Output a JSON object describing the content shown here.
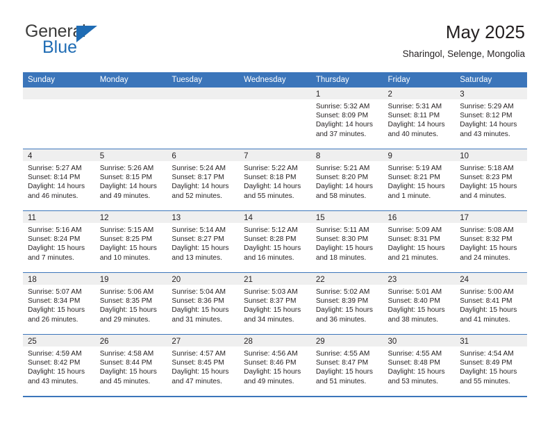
{
  "brand": {
    "name_part1": "General",
    "name_part2": "Blue",
    "logo_icon": "triangle-logo-icon"
  },
  "header": {
    "title": "May 2025",
    "subtitle": "Sharingol, Selenge, Mongolia"
  },
  "calendar": {
    "weekday_headers": [
      "Sunday",
      "Monday",
      "Tuesday",
      "Wednesday",
      "Thursday",
      "Friday",
      "Saturday"
    ],
    "accent_color": "#3b75ba",
    "daynum_band_color": "#efefef",
    "weeks": [
      [
        {
          "day": "",
          "lines": []
        },
        {
          "day": "",
          "lines": []
        },
        {
          "day": "",
          "lines": []
        },
        {
          "day": "",
          "lines": []
        },
        {
          "day": "1",
          "lines": [
            "Sunrise: 5:32 AM",
            "Sunset: 8:09 PM",
            "Daylight: 14 hours",
            "and 37 minutes."
          ]
        },
        {
          "day": "2",
          "lines": [
            "Sunrise: 5:31 AM",
            "Sunset: 8:11 PM",
            "Daylight: 14 hours",
            "and 40 minutes."
          ]
        },
        {
          "day": "3",
          "lines": [
            "Sunrise: 5:29 AM",
            "Sunset: 8:12 PM",
            "Daylight: 14 hours",
            "and 43 minutes."
          ]
        }
      ],
      [
        {
          "day": "4",
          "lines": [
            "Sunrise: 5:27 AM",
            "Sunset: 8:14 PM",
            "Daylight: 14 hours",
            "and 46 minutes."
          ]
        },
        {
          "day": "5",
          "lines": [
            "Sunrise: 5:26 AM",
            "Sunset: 8:15 PM",
            "Daylight: 14 hours",
            "and 49 minutes."
          ]
        },
        {
          "day": "6",
          "lines": [
            "Sunrise: 5:24 AM",
            "Sunset: 8:17 PM",
            "Daylight: 14 hours",
            "and 52 minutes."
          ]
        },
        {
          "day": "7",
          "lines": [
            "Sunrise: 5:22 AM",
            "Sunset: 8:18 PM",
            "Daylight: 14 hours",
            "and 55 minutes."
          ]
        },
        {
          "day": "8",
          "lines": [
            "Sunrise: 5:21 AM",
            "Sunset: 8:20 PM",
            "Daylight: 14 hours",
            "and 58 minutes."
          ]
        },
        {
          "day": "9",
          "lines": [
            "Sunrise: 5:19 AM",
            "Sunset: 8:21 PM",
            "Daylight: 15 hours",
            "and 1 minute."
          ]
        },
        {
          "day": "10",
          "lines": [
            "Sunrise: 5:18 AM",
            "Sunset: 8:23 PM",
            "Daylight: 15 hours",
            "and 4 minutes."
          ]
        }
      ],
      [
        {
          "day": "11",
          "lines": [
            "Sunrise: 5:16 AM",
            "Sunset: 8:24 PM",
            "Daylight: 15 hours",
            "and 7 minutes."
          ]
        },
        {
          "day": "12",
          "lines": [
            "Sunrise: 5:15 AM",
            "Sunset: 8:25 PM",
            "Daylight: 15 hours",
            "and 10 minutes."
          ]
        },
        {
          "day": "13",
          "lines": [
            "Sunrise: 5:14 AM",
            "Sunset: 8:27 PM",
            "Daylight: 15 hours",
            "and 13 minutes."
          ]
        },
        {
          "day": "14",
          "lines": [
            "Sunrise: 5:12 AM",
            "Sunset: 8:28 PM",
            "Daylight: 15 hours",
            "and 16 minutes."
          ]
        },
        {
          "day": "15",
          "lines": [
            "Sunrise: 5:11 AM",
            "Sunset: 8:30 PM",
            "Daylight: 15 hours",
            "and 18 minutes."
          ]
        },
        {
          "day": "16",
          "lines": [
            "Sunrise: 5:09 AM",
            "Sunset: 8:31 PM",
            "Daylight: 15 hours",
            "and 21 minutes."
          ]
        },
        {
          "day": "17",
          "lines": [
            "Sunrise: 5:08 AM",
            "Sunset: 8:32 PM",
            "Daylight: 15 hours",
            "and 24 minutes."
          ]
        }
      ],
      [
        {
          "day": "18",
          "lines": [
            "Sunrise: 5:07 AM",
            "Sunset: 8:34 PM",
            "Daylight: 15 hours",
            "and 26 minutes."
          ]
        },
        {
          "day": "19",
          "lines": [
            "Sunrise: 5:06 AM",
            "Sunset: 8:35 PM",
            "Daylight: 15 hours",
            "and 29 minutes."
          ]
        },
        {
          "day": "20",
          "lines": [
            "Sunrise: 5:04 AM",
            "Sunset: 8:36 PM",
            "Daylight: 15 hours",
            "and 31 minutes."
          ]
        },
        {
          "day": "21",
          "lines": [
            "Sunrise: 5:03 AM",
            "Sunset: 8:37 PM",
            "Daylight: 15 hours",
            "and 34 minutes."
          ]
        },
        {
          "day": "22",
          "lines": [
            "Sunrise: 5:02 AM",
            "Sunset: 8:39 PM",
            "Daylight: 15 hours",
            "and 36 minutes."
          ]
        },
        {
          "day": "23",
          "lines": [
            "Sunrise: 5:01 AM",
            "Sunset: 8:40 PM",
            "Daylight: 15 hours",
            "and 38 minutes."
          ]
        },
        {
          "day": "24",
          "lines": [
            "Sunrise: 5:00 AM",
            "Sunset: 8:41 PM",
            "Daylight: 15 hours",
            "and 41 minutes."
          ]
        }
      ],
      [
        {
          "day": "25",
          "lines": [
            "Sunrise: 4:59 AM",
            "Sunset: 8:42 PM",
            "Daylight: 15 hours",
            "and 43 minutes."
          ]
        },
        {
          "day": "26",
          "lines": [
            "Sunrise: 4:58 AM",
            "Sunset: 8:44 PM",
            "Daylight: 15 hours",
            "and 45 minutes."
          ]
        },
        {
          "day": "27",
          "lines": [
            "Sunrise: 4:57 AM",
            "Sunset: 8:45 PM",
            "Daylight: 15 hours",
            "and 47 minutes."
          ]
        },
        {
          "day": "28",
          "lines": [
            "Sunrise: 4:56 AM",
            "Sunset: 8:46 PM",
            "Daylight: 15 hours",
            "and 49 minutes."
          ]
        },
        {
          "day": "29",
          "lines": [
            "Sunrise: 4:55 AM",
            "Sunset: 8:47 PM",
            "Daylight: 15 hours",
            "and 51 minutes."
          ]
        },
        {
          "day": "30",
          "lines": [
            "Sunrise: 4:55 AM",
            "Sunset: 8:48 PM",
            "Daylight: 15 hours",
            "and 53 minutes."
          ]
        },
        {
          "day": "31",
          "lines": [
            "Sunrise: 4:54 AM",
            "Sunset: 8:49 PM",
            "Daylight: 15 hours",
            "and 55 minutes."
          ]
        }
      ]
    ]
  }
}
